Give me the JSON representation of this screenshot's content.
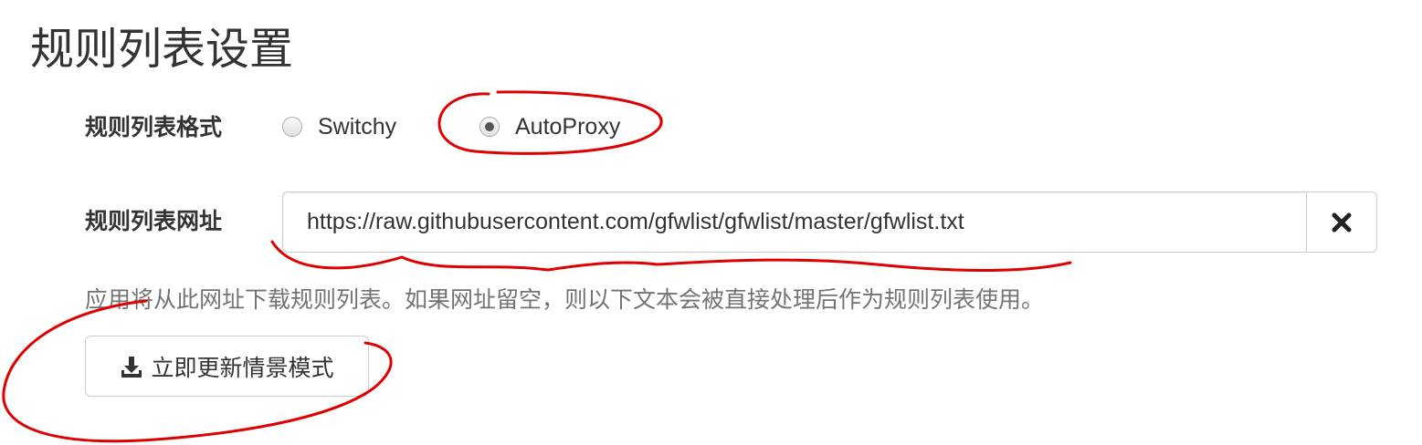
{
  "section": {
    "title": "规则列表设置"
  },
  "format": {
    "label": "规则列表格式",
    "options": [
      {
        "label": "Switchy",
        "selected": false
      },
      {
        "label": "AutoProxy",
        "selected": true
      }
    ]
  },
  "url": {
    "label": "规则列表网址",
    "value": "https://raw.githubusercontent.com/gfwlist/gfwlist/master/gfwlist.txt",
    "clear_icon": "times-icon"
  },
  "help": {
    "text": "应用将从此网址下载规则列表。如果网址留空，则以下文本会被直接处理后作为规则列表使用。"
  },
  "update_button": {
    "label": "立即更新情景模式",
    "icon": "download-icon"
  },
  "annotation_color": "#e00000"
}
